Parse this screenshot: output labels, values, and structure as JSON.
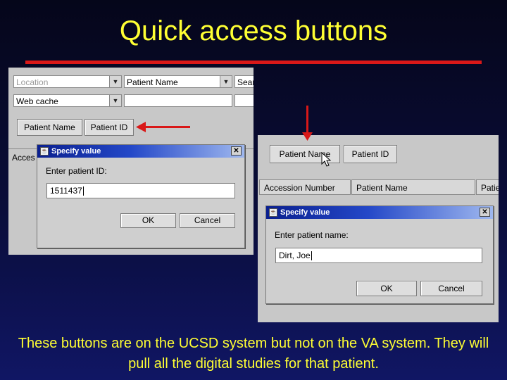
{
  "slide": {
    "title": "Quick access buttons",
    "caption": "These buttons are on the UCSD system but not on the VA system.  They will pull all the digital studies for that patient.",
    "title_color": "#ffff33",
    "arrow_color": "#d91818"
  },
  "left_screen": {
    "location_combo": "Location",
    "patient_name_combo": "Patient Name",
    "search_partial": "Sear",
    "web_cache_combo": "Web cache",
    "patient_name_button": "Patient Name",
    "patient_id_button": "Patient ID",
    "column_partial": "Acces",
    "dialog": {
      "title": "Specify value",
      "prompt": "Enter patient ID:",
      "value": "1511437",
      "ok": "OK",
      "cancel": "Cancel"
    }
  },
  "right_screen": {
    "patient_name_button": "Patient Name",
    "patient_id_button": "Patient ID",
    "columns": [
      "Accession Number",
      "Patient Name",
      "Patie"
    ],
    "dialog": {
      "title": "Specify value",
      "prompt": "Enter patient name:",
      "value": "Dirt, Joe",
      "ok": "OK",
      "cancel": "Cancel"
    }
  }
}
